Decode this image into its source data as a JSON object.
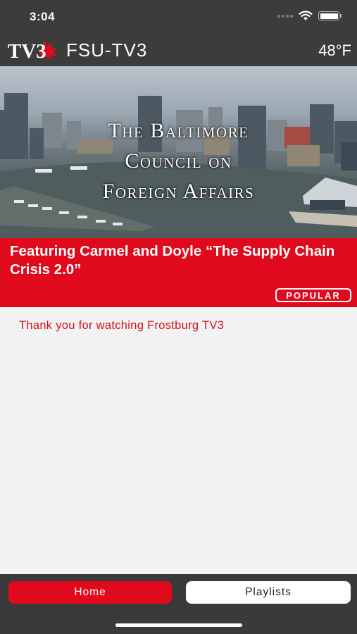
{
  "status_bar": {
    "time": "3:04",
    "icons": [
      "signal-dots-icon",
      "wifi-icon",
      "battery-icon"
    ]
  },
  "app_bar": {
    "logo_text": "TV3",
    "title": "FSU-TV3",
    "temperature": "48°F"
  },
  "hero": {
    "title_lines": [
      "The Baltimore",
      "Council on",
      "Foreign Affairs"
    ]
  },
  "featured": {
    "title": "Featuring Carmel and Doyle “The Supply Chain Crisis 2.0”",
    "badge": "POPULAR"
  },
  "message": "Thank you for watching Frostburg TV3",
  "tabs": {
    "home": "Home",
    "playlists": "Playlists"
  },
  "colors": {
    "brand_red": "#e1091c",
    "bar_gray": "#3c3c3c",
    "background": "#f2f2f2"
  }
}
